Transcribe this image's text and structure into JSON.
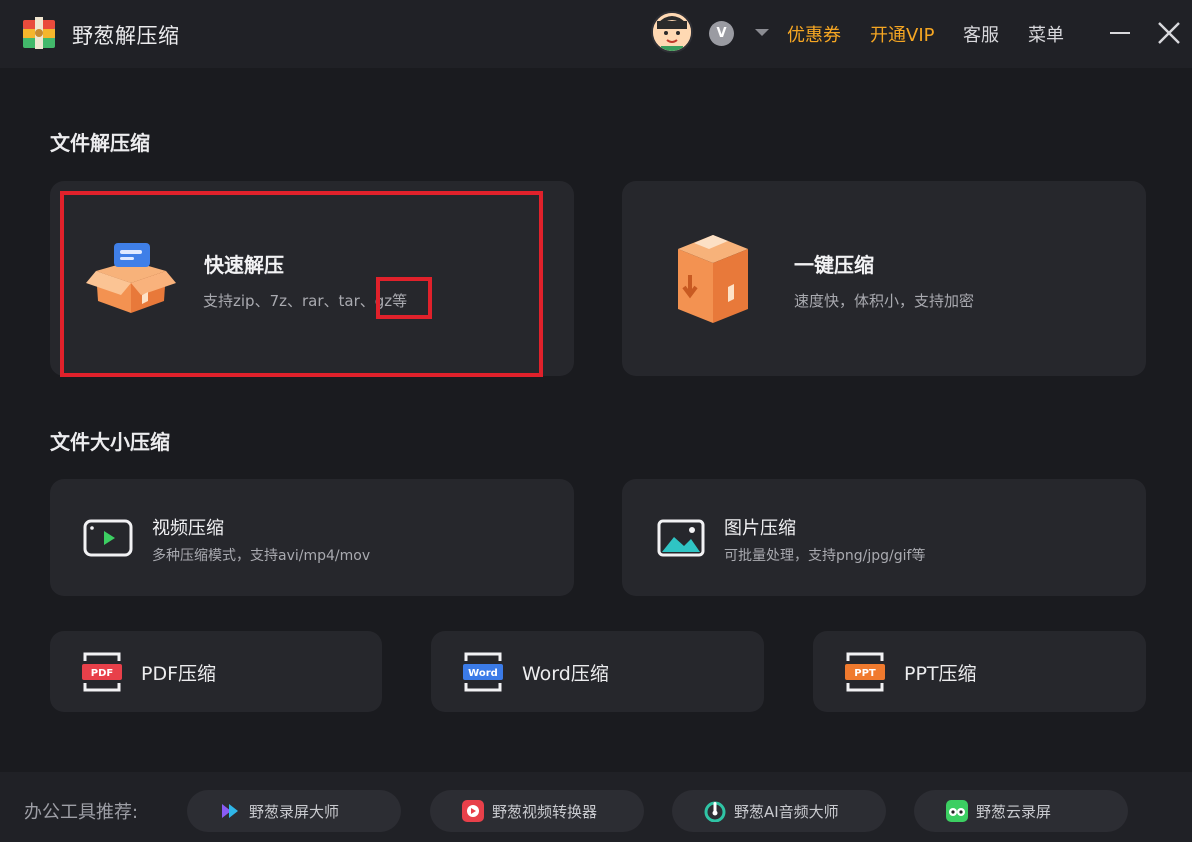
{
  "app": {
    "title": "野葱解压缩"
  },
  "header": {
    "vip_badge": "V",
    "coupon": "优惠券",
    "open_vip": "开通VIP",
    "service": "客服",
    "menu": "菜单"
  },
  "sections": {
    "decompress_title": "文件解压缩",
    "size_title": "文件大小压缩"
  },
  "cards": {
    "quick_extract": {
      "title": "快速解压",
      "desc": "支持zip、7z、rar、tar、gz等"
    },
    "one_click": {
      "title": "一键压缩",
      "desc": "速度快，体积小，支持加密"
    },
    "video": {
      "title": "视频压缩",
      "desc": "多种压缩模式，支持avi/mp4/mov"
    },
    "image": {
      "title": "图片压缩",
      "desc": "可批量处理，支持png/jpg/gif等"
    },
    "pdf": {
      "title": "PDF压缩",
      "icon_text": "PDF"
    },
    "word": {
      "title": "Word压缩",
      "icon_text": "Word"
    },
    "ppt": {
      "title": "PPT压缩",
      "icon_text": "PPT"
    }
  },
  "footer": {
    "label": "办公工具推荐:",
    "tools": [
      {
        "label": "野葱录屏大师"
      },
      {
        "label": "野葱视频转换器"
      },
      {
        "label": "野葱AI音频大师"
      },
      {
        "label": "野葱云录屏"
      }
    ]
  },
  "colors": {
    "accent": "#f5a623",
    "highlight_red": "#e0212b",
    "background": "#1a1b1f",
    "card": "#26272c"
  }
}
